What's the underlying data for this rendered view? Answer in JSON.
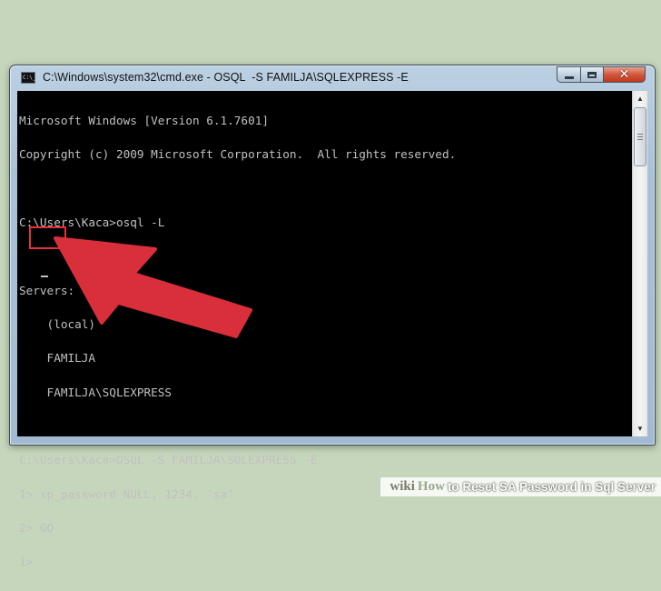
{
  "window": {
    "title": "C:\\Windows\\system32\\cmd.exe - OSQL  -S FAMILJA\\SQLEXPRESS -E",
    "icon": "cmd-icon",
    "controls": {
      "minimize": "minimize-icon",
      "maximize": "maximize-icon",
      "close": "close-icon"
    }
  },
  "console": {
    "lines": [
      "Microsoft Windows [Version 6.1.7601]",
      "Copyright (c) 2009 Microsoft Corporation.  All rights reserved.",
      "",
      "C:\\Users\\Kaca>osql -L",
      "",
      "Servers:",
      "    (local)",
      "    FAMILJA",
      "    FAMILJA\\SQLEXPRESS",
      "",
      "C:\\Users\\Kaca>OSQL -S FAMILJA\\SQLEXPRESS -E",
      "1> sp_password NULL, 1234, 'sa'",
      "2> GO",
      "1> "
    ],
    "text_color": "#c0c0c0",
    "background": "#000000"
  },
  "annotation": {
    "highlight_color": "#e5303a",
    "arrow_color": "#d92f3b",
    "arrow_icon": "arrow-pointer-icon"
  },
  "footer": {
    "brand_wiki": "wiki",
    "brand_how": "How",
    "title": "to Reset SA Password in Sql Server"
  }
}
